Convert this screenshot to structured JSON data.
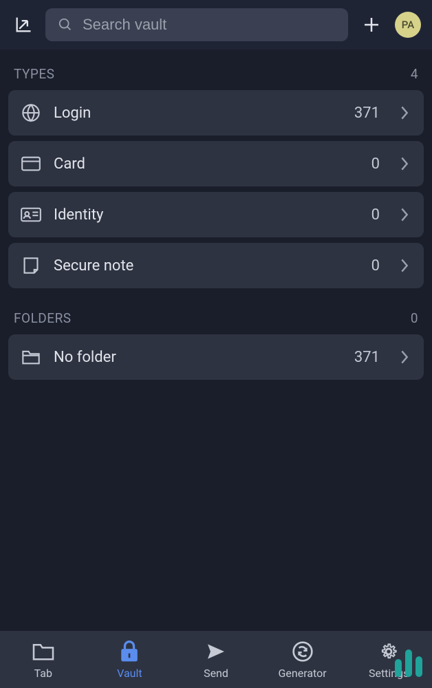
{
  "header": {
    "search_placeholder": "Search vault",
    "avatar_initials": "PA"
  },
  "sections": {
    "types": {
      "title": "TYPES",
      "count": "4",
      "items": [
        {
          "label": "Login",
          "count": "371"
        },
        {
          "label": "Card",
          "count": "0"
        },
        {
          "label": "Identity",
          "count": "0"
        },
        {
          "label": "Secure note",
          "count": "0"
        }
      ]
    },
    "folders": {
      "title": "FOLDERS",
      "count": "0",
      "items": [
        {
          "label": "No folder",
          "count": "371"
        }
      ]
    }
  },
  "nav": {
    "tab": "Tab",
    "vault": "Vault",
    "send": "Send",
    "generator": "Generator",
    "settings": "Settings"
  }
}
